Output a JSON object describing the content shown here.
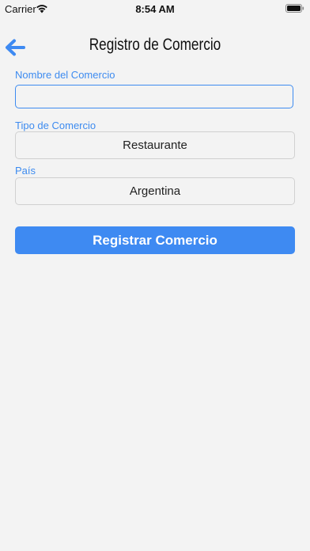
{
  "status_bar": {
    "carrier": "Carrier",
    "time": "8:54 AM"
  },
  "nav": {
    "title": "Registro de Comercio",
    "back_icon": "arrow-left-icon"
  },
  "form": {
    "name_field": {
      "label": "Nombre del Comercio",
      "value": "",
      "placeholder": ""
    },
    "type_field": {
      "label": "Tipo de Comercio",
      "selected": "Restaurante"
    },
    "country_field": {
      "label": "País",
      "selected": "Argentina"
    },
    "submit_label": "Registrar Comercio"
  },
  "colors": {
    "accent": "#3e8af2",
    "label": "#3d8bf0",
    "background": "#f3f3f3"
  }
}
